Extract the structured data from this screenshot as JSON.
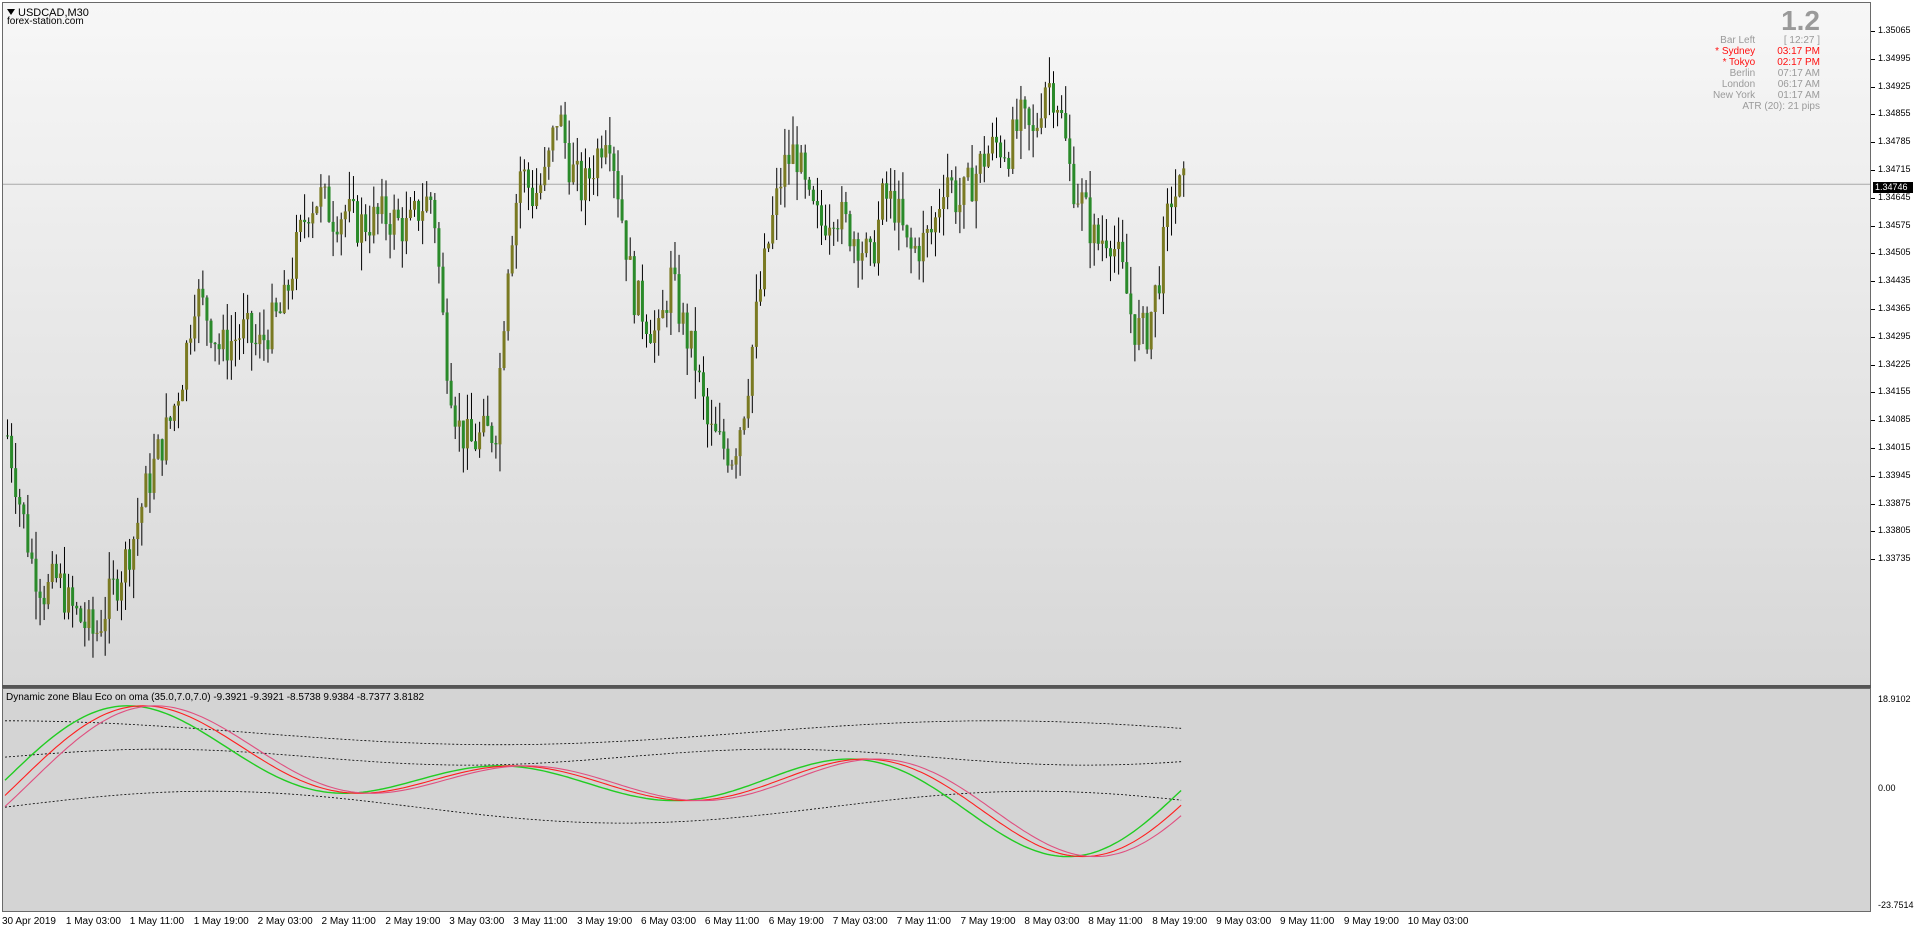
{
  "symbol": "USDCAD,M30",
  "broker": "forex-station.com",
  "info": {
    "big_value": "1.2",
    "rows": [
      {
        "label": "Bar Left",
        "value": "[ 12:27 ]",
        "highlight": false
      },
      {
        "label": "* Sydney",
        "value": "03:17 PM",
        "highlight": true
      },
      {
        "label": "* Tokyo",
        "value": "02:17 PM",
        "highlight": true
      },
      {
        "label": "Berlin",
        "value": "07:17 AM",
        "highlight": false
      },
      {
        "label": "London",
        "value": "06:17 AM",
        "highlight": false
      },
      {
        "label": "New York",
        "value": "01:17 AM",
        "highlight": false
      }
    ],
    "atr": "ATR (20): 21 pips"
  },
  "indicator_label": "Dynamic zone Blau Eco on oma (35.0,7.0,7.0) -9.3921 -9.3921 -8.5738 9.9384 -8.7377 3.8182",
  "price_axis": [
    "1.35065",
    "1.34995",
    "1.34925",
    "1.34855",
    "1.34785",
    "1.34715",
    "1.34645",
    "1.34575",
    "1.34505",
    "1.34435",
    "1.34365",
    "1.34295",
    "1.34225",
    "1.34155",
    "1.34085",
    "1.34015",
    "1.33945",
    "1.33875",
    "1.33805",
    "1.33735"
  ],
  "current_price": "1.34746",
  "indicator_axis": [
    "18.9102",
    "0.00",
    "-23.7514"
  ],
  "time_axis": [
    "30 Apr 2019",
    "1 May 03:00",
    "1 May 11:00",
    "1 May 19:00",
    "2 May 03:00",
    "2 May 11:00",
    "2 May 19:00",
    "3 May 03:00",
    "3 May 11:00",
    "3 May 19:00",
    "6 May 03:00",
    "6 May 11:00",
    "6 May 19:00",
    "7 May 03:00",
    "7 May 11:00",
    "7 May 19:00",
    "8 May 03:00",
    "8 May 11:00",
    "8 May 19:00",
    "9 May 03:00",
    "9 May 11:00",
    "9 May 19:00",
    "10 May 03:00"
  ],
  "colors": {
    "bull": "#7a7a22",
    "bear": "#2a8a2a",
    "wick": "#000000",
    "line_green": "#22cc22",
    "line_red": "#ff2020",
    "line_pink": "#e05080"
  },
  "chart_data": {
    "type": "candlestick",
    "y_range": [
      1.33735,
      1.35065
    ],
    "close_path": [
      1.3422,
      1.3408,
      1.3395,
      1.3389,
      1.3392,
      1.3386,
      1.3383,
      1.338,
      1.3387,
      1.3393,
      1.34,
      1.341,
      1.3418,
      1.3425,
      1.3435,
      1.3452,
      1.3447,
      1.344,
      1.3442,
      1.3444,
      1.344,
      1.3445,
      1.3448,
      1.346,
      1.347,
      1.3472,
      1.3468,
      1.3469,
      1.3466,
      1.3467,
      1.3468,
      1.3467,
      1.3465,
      1.347,
      1.3472,
      1.344,
      1.3424,
      1.342,
      1.3422,
      1.3423,
      1.3459,
      1.3478,
      1.3472,
      1.3476,
      1.349,
      1.3478,
      1.3473,
      1.348,
      1.3488,
      1.347,
      1.3452,
      1.3447,
      1.3442,
      1.3455,
      1.3445,
      1.3437,
      1.3423,
      1.342,
      1.3418,
      1.343,
      1.345,
      1.3465,
      1.3478,
      1.3482,
      1.347,
      1.3466,
      1.347,
      1.3466,
      1.3463,
      1.3458,
      1.3472,
      1.347,
      1.346,
      1.3462,
      1.3465,
      1.3478,
      1.347,
      1.3475,
      1.348,
      1.3483,
      1.3482,
      1.3488,
      1.3484,
      1.3497,
      1.3492,
      1.3476,
      1.347,
      1.3462,
      1.3465,
      1.3457,
      1.3445,
      1.3443,
      1.3455,
      1.3472,
      1.3474
    ],
    "indicator_range": [
      -23.7514,
      18.9102
    ],
    "levels": [
      -9.3921,
      -8.5738,
      9.9384,
      -8.7377,
      3.8182
    ]
  }
}
